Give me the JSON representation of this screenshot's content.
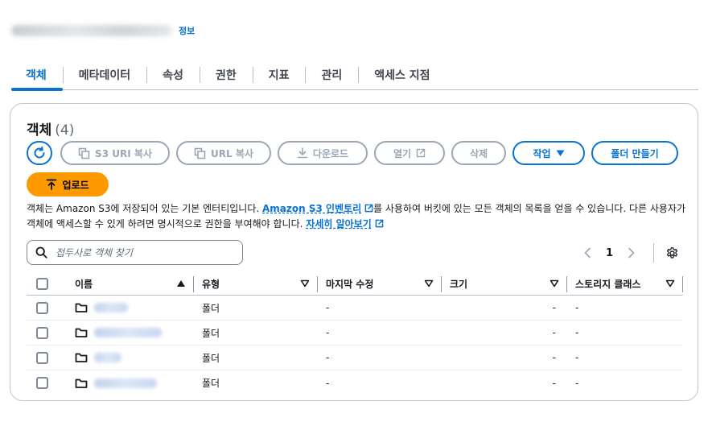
{
  "header": {
    "info_link": "정보"
  },
  "tabs": [
    {
      "label": "객체",
      "active": true
    },
    {
      "label": "메타데이터",
      "active": false
    },
    {
      "label": "속성",
      "active": false
    },
    {
      "label": "권한",
      "active": false
    },
    {
      "label": "지표",
      "active": false
    },
    {
      "label": "관리",
      "active": false
    },
    {
      "label": "액세스 지점",
      "active": false
    }
  ],
  "objects": {
    "title": "객체",
    "count": "(4)",
    "buttons": {
      "copy_s3_uri": "S3 URI 복사",
      "copy_url": "URL 복사",
      "download": "다운로드",
      "open": "열기",
      "delete": "삭제",
      "actions": "작업",
      "create_folder": "폴더 만들기",
      "upload": "업로드"
    },
    "description": {
      "part1": "객체는 Amazon S3에 저장되어 있는 기본 엔터티입니다. ",
      "inventory_link": "Amazon S3 인벤토리",
      "part2": "를 사용하여 버킷에 있는 모든 객체의 목록을 얻을 수 있습니다. 다른 사용자가 객체에 액세스할 수 있게 하려면 명시적으로 권한을 부여해야 합니다. ",
      "learn_more": "자세히 알아보기"
    },
    "search_placeholder": "접두사로 객체 찾기",
    "page": "1",
    "columns": {
      "name": "이름",
      "type": "유형",
      "last_modified": "마지막 수정",
      "size": "크기",
      "storage_class": "스토리지 클래스"
    },
    "rows": [
      {
        "type": "폴더",
        "last_modified": "-",
        "size": "-",
        "storage_class": "-"
      },
      {
        "type": "폴더",
        "last_modified": "-",
        "size": "-",
        "storage_class": "-"
      },
      {
        "type": "폴더",
        "last_modified": "-",
        "size": "-",
        "storage_class": "-"
      },
      {
        "type": "폴더",
        "last_modified": "-",
        "size": "-",
        "storage_class": "-"
      }
    ]
  },
  "colors": {
    "accent": "#0972d3",
    "upload": "#ff9900",
    "disabled": "#9ba7b6",
    "text": "#16191f"
  }
}
